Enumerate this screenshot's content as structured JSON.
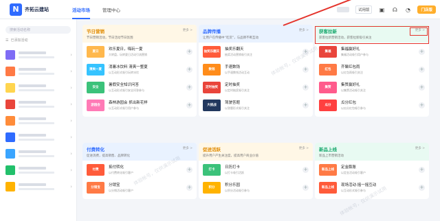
{
  "app": {
    "logo_letter": "N",
    "name": "齐拓云建站"
  },
  "nav": {
    "tabs": [
      "活动市场",
      "管理中心"
    ],
    "active": 0
  },
  "topbar": {
    "version": "试用版",
    "vip_label": "门店版"
  },
  "sidebar": {
    "search_placeholder": "搜索活动名称",
    "section_label": "已添加活动",
    "thumb_colors": [
      "#7f6cf5",
      "#ff7a45",
      "#ffd54f",
      "#e9453b",
      "#ff8c3a",
      "#2f6bff",
      "#3aa5ff",
      "#22c06b",
      "#ffb300"
    ]
  },
  "cards": [
    {
      "title": "节日营销",
      "subtitle": "节日营销活动，节日活动节日氛围",
      "more": "更多 >",
      "head_color": "#fff7e6",
      "title_color": "#e08a00",
      "rows": [
        {
          "title": "欢乐夏日，嗨玩一夏",
          "desc": "大转盘，玩转夏日活动引流营销",
          "thumb": "#ffb84d",
          "thumb_text": "夏日"
        },
        {
          "title": "消暑冰饮料 清爽一整夏",
          "desc": "以互动形式吸引玩转冰饮",
          "thumb": "#35c3ff",
          "thumb_text": "清爽一夏"
        },
        {
          "title": "暑假安全知识问答",
          "desc": "以互动形式吸引安全问答参与",
          "thumb": "#3bc27a",
          "thumb_text": "安全"
        },
        {
          "title": "森林游园会 抓出新花样",
          "desc": "以互动形式吸引用户参与",
          "thumb": "#ff7ab6",
          "thumb_text": "游园会"
        }
      ]
    },
    {
      "title": "品牌传播",
      "subtitle": "让用户在传播中“吃货”，与品牌不断互动",
      "more": "更多 >",
      "head_color": "#e9f2ff",
      "title_color": "#2f6bff",
      "rows": [
        {
          "title": "抽奖乐翻天",
          "desc": "抽奖活动营销吸引关注",
          "thumb": "#ff5b3a",
          "thumb_text": "抽奖乐翻天"
        },
        {
          "title": "手速数钱",
          "desc": "以手速数钱活动互动",
          "thumb": "#ff8c1a",
          "thumb_text": "数钱"
        },
        {
          "title": "定时抽奖",
          "desc": "以定时抽奖吸引关注",
          "thumb": "#e9453b",
          "thumb_text": "定时抽奖"
        },
        {
          "title": "驾驶答题",
          "desc": "以答题形式吸引关注",
          "thumb": "#22385e",
          "thumb_text": "大挑战"
        }
      ]
    },
    {
      "title": "获客拉新",
      "subtitle": "获客拉新营销活动，获客拉新吸引关注",
      "more": "更多 >",
      "head_color": "#e8faf2",
      "title_color": "#13a66a",
      "rows": [
        {
          "title": "集福赢好礼",
          "desc": "集福活动吸引用户参与",
          "thumb": "#e9453b",
          "thumb_text": "集福"
        },
        {
          "title": "齐聚红包雨",
          "desc": "以红包雨吸引关注",
          "thumb": "#ff7a45",
          "thumb_text": "红包"
        },
        {
          "title": "集赞赢好礼",
          "desc": "以集赞活动吸引关注",
          "thumb": "#ff5b8c",
          "thumb_text": "集赞"
        },
        {
          "title": "瓜分红包",
          "desc": "以瓜分红包吸引参与",
          "thumb": "#ff4040",
          "thumb_text": "瓜分"
        }
      ]
    },
    {
      "title": "付费转化",
      "subtitle": "促进消费，提高销售、品牌转化",
      "more": "更多 >",
      "head_color": "#e9f2ff",
      "title_color": "#2f6bff",
      "rows": [
        {
          "title": "拓付转化",
          "desc": "以付费转化吸引客户",
          "thumb": "#ff5b3a",
          "thumb_text": "付费"
        },
        {
          "title": "分销宝",
          "desc": "以分销活动吸引客户",
          "thumb": "#ff7a45",
          "thumb_text": "分销宝"
        }
      ]
    },
    {
      "title": "促进活跃",
      "subtitle": "提升用户产生关注度，提高用户商业价值",
      "more": "更多 >",
      "head_color": "#fff7e6",
      "title_color": "#e08a00",
      "rows": [
        {
          "title": "日历打卡",
          "desc": "以打卡吸引活跃",
          "thumb": "#3bc27a",
          "thumb_text": "打卡"
        },
        {
          "title": "积分乐园",
          "desc": "以积分活动吸引参与",
          "thumb": "#ffb300",
          "thumb_text": "积分"
        }
      ]
    },
    {
      "title": "新品上线",
      "subtitle": "新品上市营销活动",
      "more": "更多 >",
      "head_color": "#e8faf2",
      "title_color": "#13a66a",
      "rows": [
        {
          "title": "定金膨胀",
          "desc": "以定金活动吸引客户",
          "thumb": "#ff7a45",
          "thumb_text": "新品上线"
        },
        {
          "title": "现场活动·摇一摇互动",
          "desc": "以互动形式吸引参与",
          "thumb": "#ff5b3a",
          "thumb_text": "新品上线"
        }
      ]
    }
  ],
  "watermark": "体验帐号，仅供演示试用"
}
